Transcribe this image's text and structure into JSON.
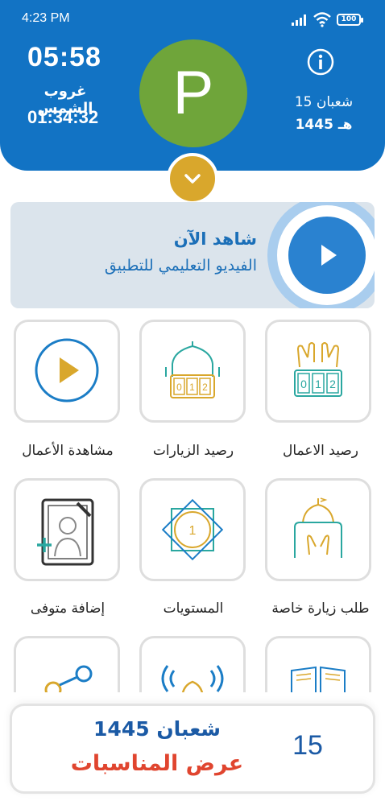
{
  "status_bar": {
    "time": "4:23 PM",
    "battery": "100",
    "icons": [
      "signal-icon",
      "wifi-icon",
      "battery-icon"
    ]
  },
  "header": {
    "clock": "05:58",
    "sunset_label": "غروب الشمس",
    "countdown": "01:34:32",
    "avatar_letter": "P",
    "hijri_day": "15 شعبان",
    "hijri_year": "1445 هـ",
    "info_icon": "info-icon",
    "toggle_icon": "chevron-down-icon"
  },
  "video_banner": {
    "title": "شاهد الآن",
    "subtitle": "الفيديو التعليمي للتطبيق",
    "icon": "play-icon"
  },
  "grid": {
    "items": [
      {
        "label": "رصيد الاعمال",
        "icon": "praying-hands-counter-icon"
      },
      {
        "label": "رصيد الزيارات",
        "icon": "dome-counter-icon"
      },
      {
        "label": "مشاهدة الأعمال",
        "icon": "play-circle-icon"
      },
      {
        "label": "طلب زيارة خاصة",
        "icon": "shrine-prayer-icon"
      },
      {
        "label": "المستويات",
        "icon": "level-badge-icon"
      },
      {
        "label": "إضافة متوفى",
        "icon": "add-deceased-icon"
      },
      {
        "label": "",
        "icon": "book-icon"
      },
      {
        "label": "",
        "icon": "broadcast-dome-icon"
      },
      {
        "label": "",
        "icon": "share-icon"
      }
    ],
    "level_badge_number": "1",
    "counter_digits": "012"
  },
  "bottom_card": {
    "day": "15",
    "month": "شعبان 1445",
    "events": "عرض المناسبات"
  },
  "colors": {
    "header_blue": "#1273c4",
    "avatar_green": "#6fa53a",
    "gold": "#d9a72c",
    "teal": "#2aa7a0",
    "event_red": "#e0452f"
  }
}
